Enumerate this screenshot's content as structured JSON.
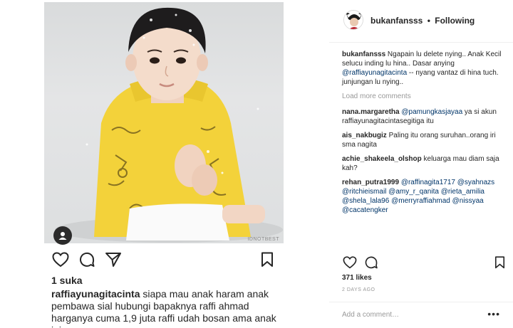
{
  "post": {
    "photo_watermark": "IDNOTBEST",
    "likes_left": "1 suka",
    "caption_left": {
      "username": "raffiayunagitacinta",
      "text": "siapa mau anak haram anak pembawa sial hubungi bapaknya raffi ahmad harganya cuma 1,9 juta raffi udah bosan ama anak ini"
    }
  },
  "header": {
    "username": "bukanfansss",
    "separator": "•",
    "follow_status": "Following"
  },
  "comments": {
    "first": {
      "user": "bukanfansss",
      "text_a": " Ngapain lu delete nying.. Anak Kecil selucu inding lu hina.. Dasar anying ",
      "mention": "@raffiayunagitacinta",
      "text_b": " -- nyang vantaz di hina tuch. junjungan lu nying.."
    },
    "load_more": "Load more comments",
    "c1": {
      "user": "nana.margaretha",
      "mention": "@pamungkasjayaa",
      "text": " ya si akun raffiayunagitacintasegitiga itu"
    },
    "c2": {
      "user": "ais_nakbugiz",
      "text": " Paling itu orang suruhan..orang iri sma nagita"
    },
    "c3": {
      "user": "achie_shakeela_olshop",
      "text": " keluarga mau diam saja kah?"
    },
    "c4": {
      "user": "rehan_putra1999",
      "m1": "@raffinagita1717",
      "m2": "@syahnazs",
      "m3": "@ritchieismail",
      "m4": "@amy_r_qanita",
      "m5": "@rieta_amilia",
      "m6": "@shela_lala96",
      "m7": "@merryraffiahmad",
      "m8": "@nissyaa",
      "m9": "@cacatengker"
    }
  },
  "right": {
    "likes": "371 likes",
    "date": "2 DAYS AGO",
    "add_comment_placeholder": "Add a comment…",
    "more": "•••"
  },
  "icons": {
    "heart": "heart-icon",
    "comment": "comment-icon",
    "share": "share-icon",
    "bookmark": "bookmark-icon",
    "tag": "user-tag-icon"
  }
}
